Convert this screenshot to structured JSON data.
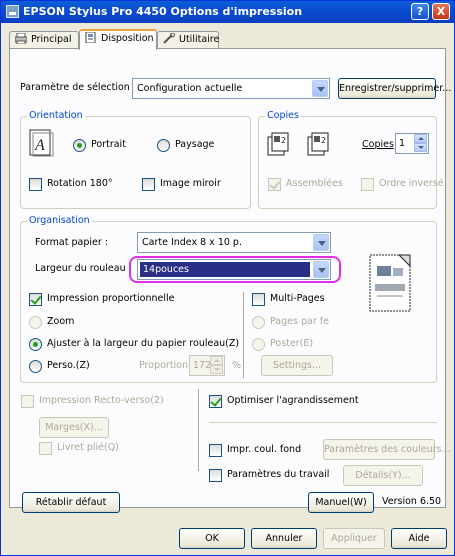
{
  "window": {
    "title": "EPSON Stylus Pro 4450 Options d'impression",
    "help_label": "?",
    "close_label": "X"
  },
  "tabs": [
    {
      "label": "Principal",
      "icon": "printer-icon"
    },
    {
      "label": "Disposition",
      "icon": "page-layout-icon"
    },
    {
      "label": "Utilitaire",
      "icon": "wrench-icon"
    }
  ],
  "selection": {
    "label": "Paramètre de sélection :",
    "value": "Configuration actuelle",
    "save_button": "Enregistrer/supprimer..."
  },
  "orientation": {
    "group_title": "Orientation",
    "portrait": "Portrait",
    "landscape": "Paysage",
    "selected": "Portrait",
    "rotation": "Rotation 180°",
    "mirror": "Image miroir"
  },
  "copies": {
    "group_title": "Copies",
    "label": "Copies",
    "value": "1",
    "collate": "Assemblées",
    "reverse": "Ordre inversé"
  },
  "organisation": {
    "group_title": "Organisation",
    "paper_format_label": "Format papier :",
    "paper_format_value": "Carte Index 8 x 10 p.",
    "roll_width_label": "Largeur du rouleau :",
    "roll_width_value": "14pouces",
    "proportional": "Impression proportionnelle",
    "zoom": "Zoom",
    "fit_roll": "Ajuster à la largeur du papier rouleau(Z)",
    "custom": "Perso.(Z)",
    "proportion_label": "Proportion",
    "proportion_value": "172",
    "percent": "%",
    "multipage": "Multi-Pages",
    "pages_per_sheet": "Pages par fe",
    "poster": "Poster(E)",
    "settings_button": "Settings..."
  },
  "bottom": {
    "duplex": "Impression Recto-verso(2)",
    "margins_button": "Marges(X)...",
    "booklet": "Livret plié(Q)",
    "optimize": "Optimiser l'agrandissement",
    "print_bg_color": "Impr. coul. fond",
    "color_settings_button": "Paramètres des couleurs...",
    "job_settings": "Paramètres du travail",
    "details_button": "Détails(Y)..."
  },
  "footer": {
    "reset_button": "Rétablir défaut",
    "manual_button": "Manuel(W)",
    "version": "Version 6.50"
  },
  "dialog_buttons": {
    "ok": "OK",
    "cancel": "Annuler",
    "apply": "Appliquer",
    "help": "Aide"
  },
  "colors": {
    "title_bar": "#0a5fd8",
    "highlight": "#e02fe0",
    "selection": "#2a2f86",
    "group_title": "#0046d5"
  }
}
